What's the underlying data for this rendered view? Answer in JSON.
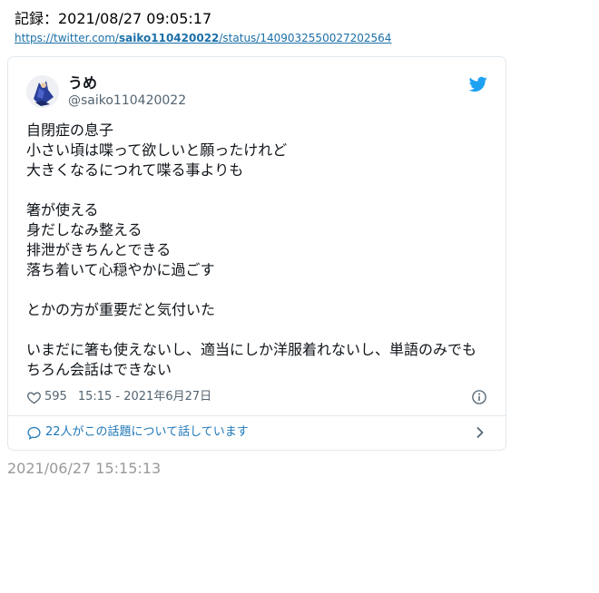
{
  "record": {
    "label": "記録：2021/08/27 09:05:17"
  },
  "source": {
    "prefix": "https://twitter.com/",
    "user": "saiko110420022",
    "suffix": "/status/1409032550027202564"
  },
  "tweet": {
    "display_name": "うめ",
    "handle": "@saiko110420022",
    "lines": [
      "自閉症の息子",
      "小さい頃は喋って欲しいと願ったけれど",
      "大きくなるにつれて喋る事よりも",
      "",
      "箸が使える",
      "身だしなみ整える",
      "排泄がきちんとできる",
      "落ち着いて心穏やかに過ごす",
      "",
      "とかの方が重要だと気付いた",
      "",
      "いまだに箸も使えないし、適当にしか洋服着れないし、単語のみでも",
      "ちろん会話はできない"
    ],
    "likes": "595",
    "timestamp": "15:15 - 2021年6月27日",
    "conversation": "22人がこの話題について話しています"
  },
  "footer": {
    "date": "2021/06/27 15:15:13"
  },
  "colors": {
    "twitter_blue": "#1da1f2",
    "link_blue": "#1a6fa8",
    "secondary_text": "#536471",
    "border": "#e1e8ed"
  },
  "icons": {
    "brand": "twitter-bird-icon",
    "like": "heart-icon",
    "info": "info-icon",
    "conversation": "speech-bubble-icon",
    "more": "chevron-right-icon"
  }
}
